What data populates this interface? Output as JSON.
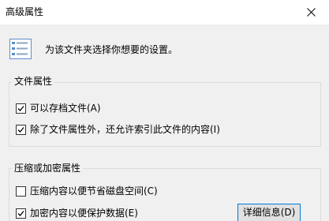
{
  "window": {
    "title": "高级属性",
    "close_icon": "close-icon"
  },
  "intro": {
    "icon": "settings-list-icon",
    "text": "为该文件夹选择你想要的设置。"
  },
  "file_attributes": {
    "legend": "文件属性",
    "items": [
      {
        "label": "可以存档文件(A)",
        "checked": true
      },
      {
        "label": "除了文件属性外，还允许索引此文件的内容(I)",
        "checked": true
      }
    ]
  },
  "compress_encrypt": {
    "legend": "压缩或加密属性",
    "items": [
      {
        "label": "压缩内容以便节省磁盘空间(C)",
        "checked": false
      },
      {
        "label": "加密内容以便保护数据(E)",
        "checked": true
      }
    ],
    "details_button": "详细信息(D)"
  },
  "colors": {
    "dialog_bg": "#f0f0f0",
    "title_bg": "#ffffff",
    "accent": "#0078d7",
    "icon_blue": "#5b8fc7"
  }
}
